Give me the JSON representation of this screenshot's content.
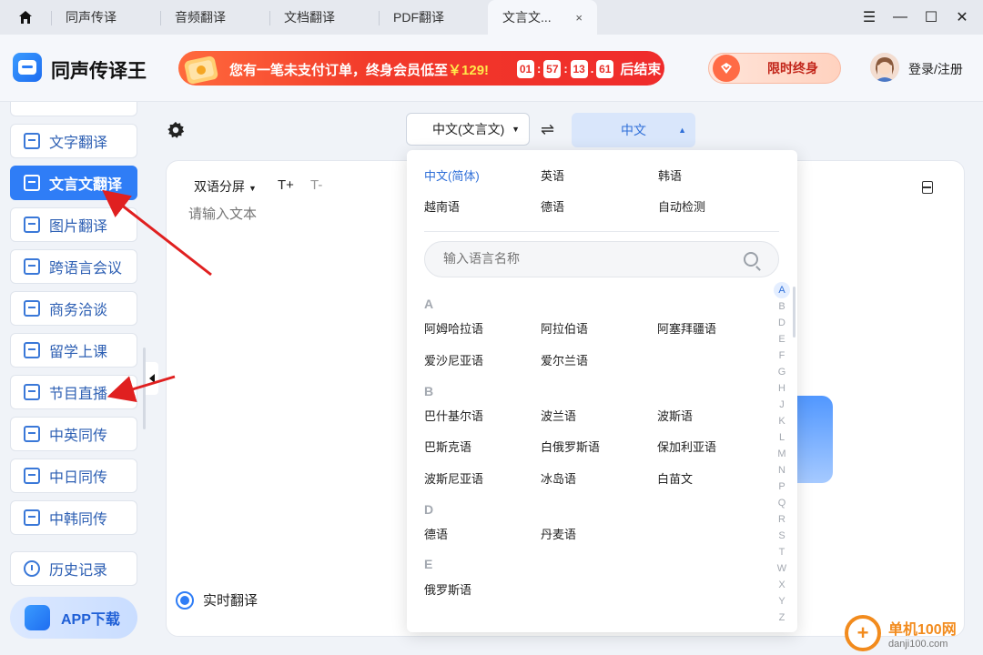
{
  "tabs": [
    {
      "label": "同声传译",
      "active": false
    },
    {
      "label": "音频翻译",
      "active": false
    },
    {
      "label": "文档翻译",
      "active": false
    },
    {
      "label": "PDF翻译",
      "active": false
    },
    {
      "label": "文言文...",
      "active": true
    }
  ],
  "tab_close": "×",
  "window_controls": {
    "menu": "☰",
    "minimize": "—",
    "maximize": "☐",
    "close": "✕"
  },
  "app": {
    "title": "同声传译王"
  },
  "promo": {
    "text": "您有一笔未支付订单，终身会员低至",
    "price": "￥129!",
    "countdown": [
      "01",
      "57",
      "13",
      "61"
    ],
    "end_text": "后结束"
  },
  "vip_button": "限时终身",
  "login": "登录/注册",
  "sidebar": {
    "items": [
      {
        "label": "文字翻译",
        "active": false
      },
      {
        "label": "文言文翻译",
        "active": true
      },
      {
        "label": "图片翻译",
        "active": false
      },
      {
        "label": "跨语言会议",
        "active": false
      },
      {
        "label": "商务洽谈",
        "active": false
      },
      {
        "label": "留学上课",
        "active": false
      },
      {
        "label": "节目直播",
        "active": false
      },
      {
        "label": "中英同传",
        "active": false
      },
      {
        "label": "中日同传",
        "active": false
      },
      {
        "label": "中韩同传",
        "active": false
      }
    ],
    "history": "历史记录",
    "app_download": "APP下载"
  },
  "toolbar": {
    "source_lang": "中文(文言文)",
    "swap": "⇌",
    "target_lang": "中文"
  },
  "editor": {
    "mode": "双语分屏",
    "font_up": "T+",
    "font_down": "T-",
    "placeholder": "请输入文本",
    "realtime": "实时翻译"
  },
  "dropdown": {
    "quick": [
      {
        "label": "中文(简体)",
        "selected": true
      },
      {
        "label": "英语",
        "selected": false
      },
      {
        "label": "韩语",
        "selected": false
      },
      {
        "label": "越南语",
        "selected": false
      },
      {
        "label": "德语",
        "selected": false
      },
      {
        "label": "自动检测",
        "selected": false
      }
    ],
    "search_placeholder": "输入语言名称",
    "groups": [
      {
        "letter": "A",
        "langs": [
          "阿姆哈拉语",
          "阿拉伯语",
          "阿塞拜疆语",
          "爱沙尼亚语",
          "爱尔兰语"
        ]
      },
      {
        "letter": "B",
        "langs": [
          "巴什基尔语",
          "波兰语",
          "波斯语",
          "巴斯克语",
          "白俄罗斯语",
          "保加利亚语",
          "波斯尼亚语",
          "冰岛语",
          "白苗文"
        ]
      },
      {
        "letter": "D",
        "langs": [
          "德语",
          "丹麦语"
        ]
      },
      {
        "letter": "E",
        "langs": [
          "俄罗斯语"
        ]
      }
    ],
    "alphabet": [
      "A",
      "B",
      "D",
      "E",
      "F",
      "G",
      "H",
      "J",
      "K",
      "L",
      "M",
      "N",
      "P",
      "Q",
      "R",
      "S",
      "T",
      "W",
      "X",
      "Y",
      "Z"
    ],
    "alphabet_current": "A"
  },
  "watermark": {
    "site": "单机100网",
    "url": "danji100.com"
  },
  "colors": {
    "accent": "#2f7df6",
    "promo": "#ef2b2b",
    "arrow": "#e02020"
  }
}
